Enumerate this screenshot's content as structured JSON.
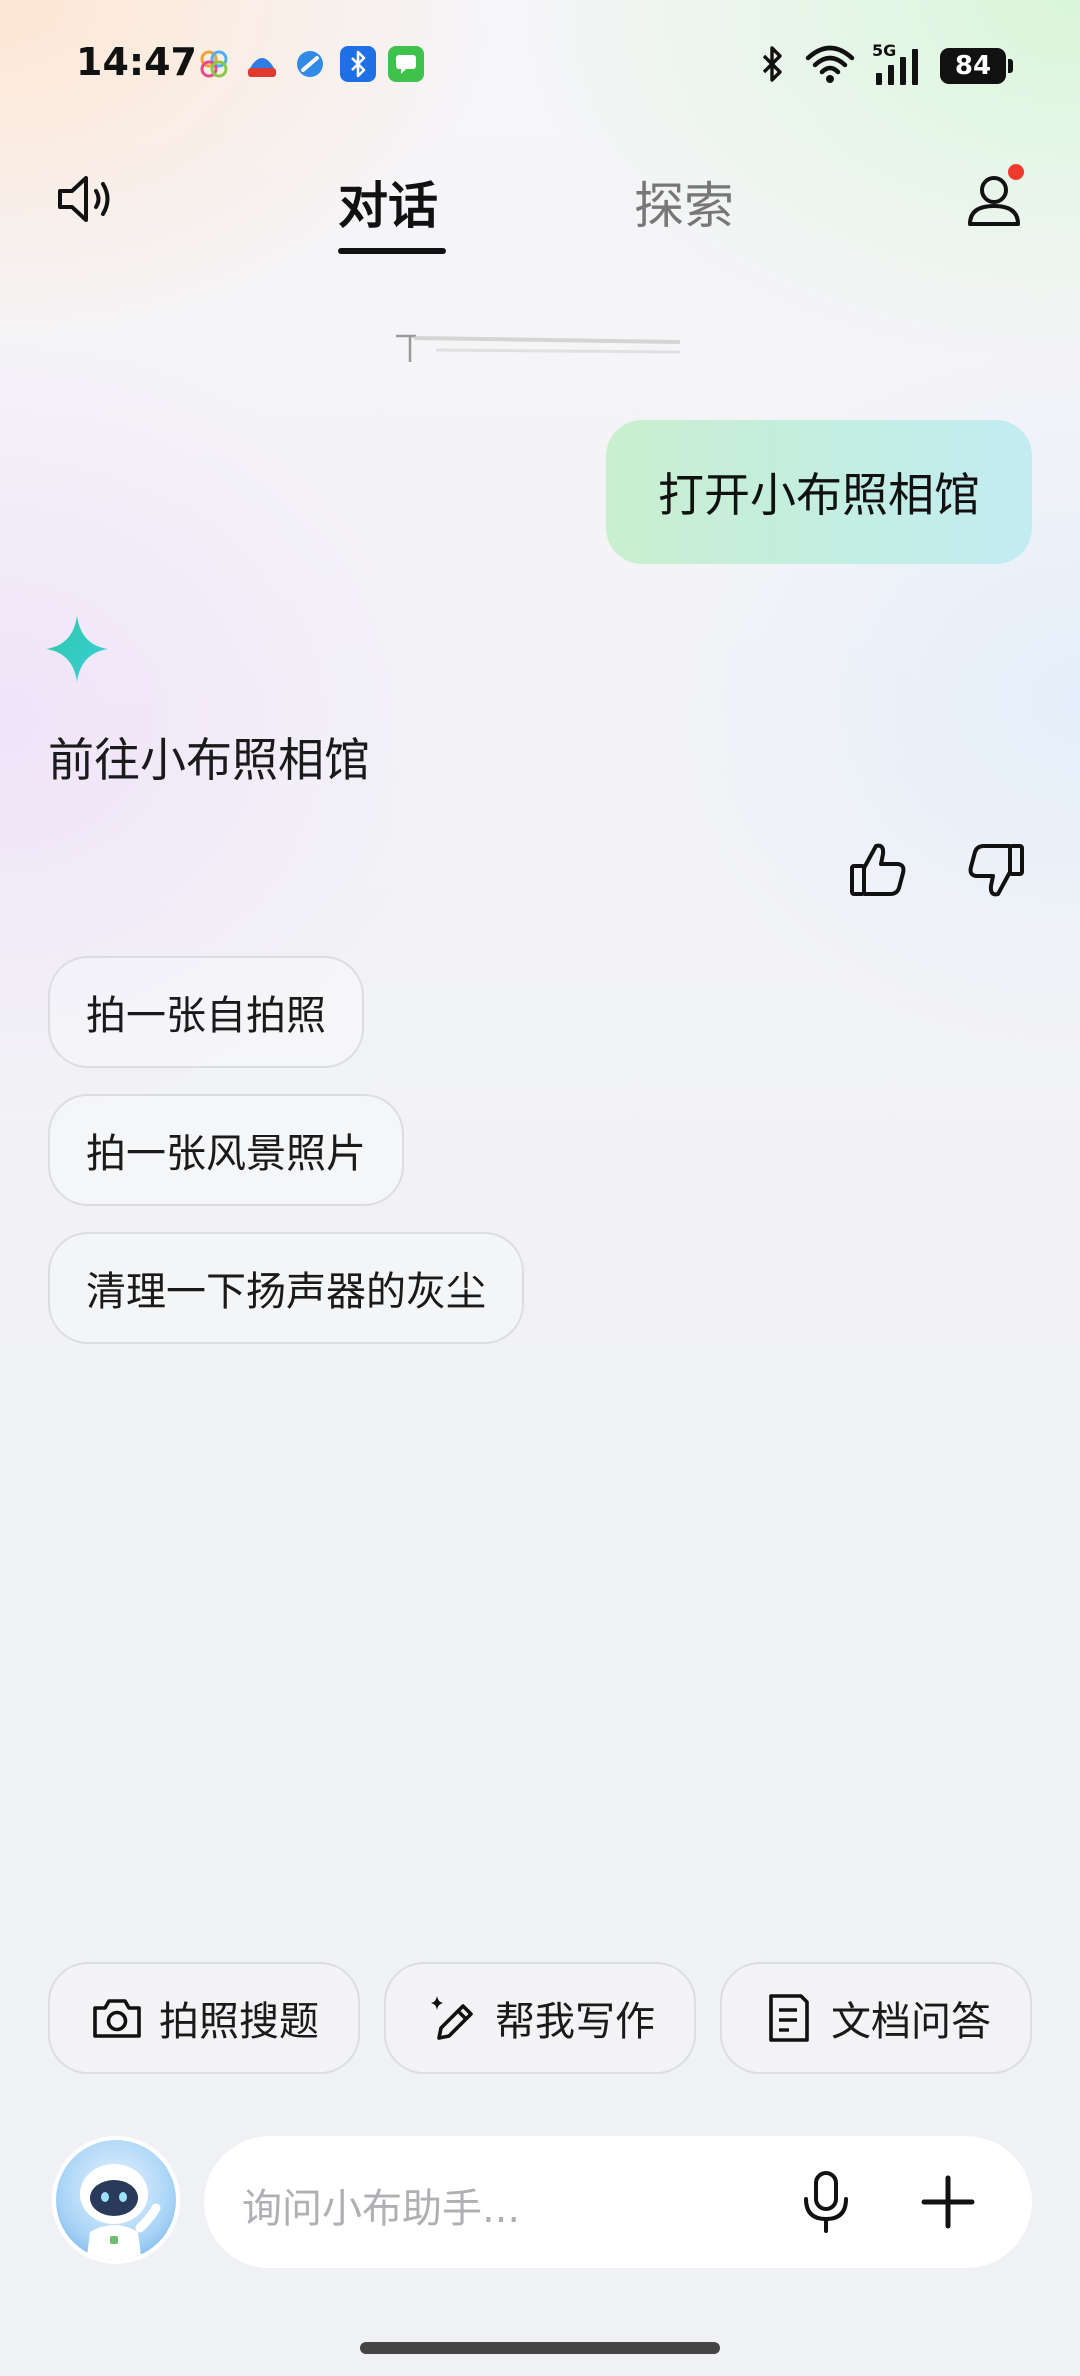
{
  "status_bar": {
    "time": "14:47",
    "network": "5G",
    "battery": "84"
  },
  "header": {
    "tab_dialog": "对话",
    "tab_explore": "探索",
    "notification_dot_color": "#ee3a2c"
  },
  "conversation": {
    "user_message": "打开小布照相馆",
    "assistant_reply": "前往小布照相馆"
  },
  "suggestions": [
    {
      "label": "拍一张自拍照"
    },
    {
      "label": "拍一张风景照片"
    },
    {
      "label": "清理一下扬声器的灰尘"
    }
  ],
  "quick_actions": [
    {
      "label": "拍照搜题",
      "icon": "camera-icon"
    },
    {
      "label": "帮我写作",
      "icon": "pen-sparkle-icon"
    },
    {
      "label": "文档问答",
      "icon": "document-icon"
    }
  ],
  "input": {
    "placeholder": "询问小布助手..."
  },
  "colors": {
    "user_bubble_start": "#c9efcf",
    "user_bubble_end": "#c2ecf1",
    "sparkle_start": "#2ec7a0",
    "sparkle_end": "#3ad0e0"
  }
}
